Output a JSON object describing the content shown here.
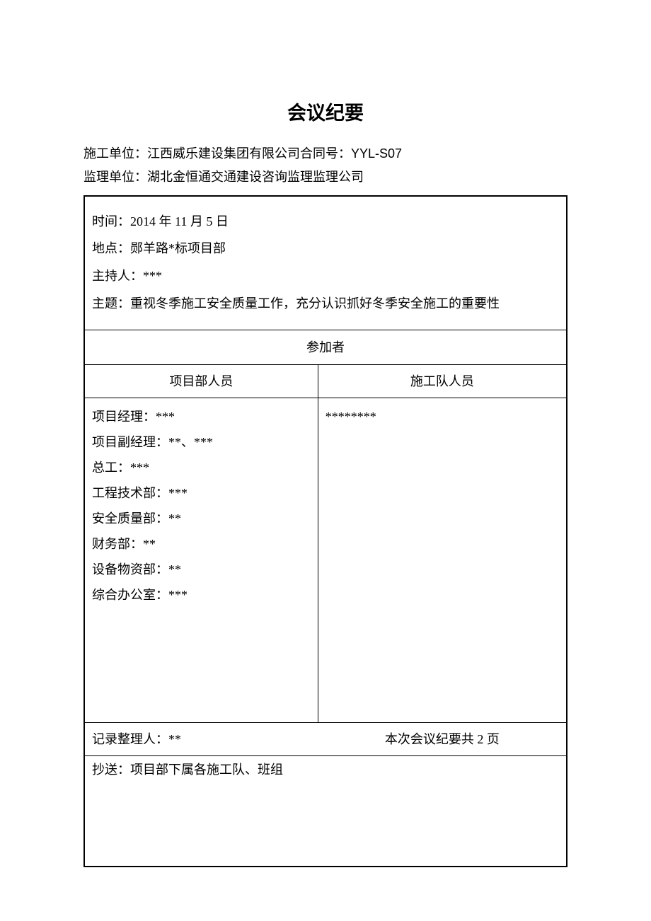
{
  "title": "会议纪要",
  "header": {
    "line1": "施工单位：江西威乐建设集团有限公司合同号：YYL-S07",
    "line2": "监理单位：湖北金恒通交通建设咨询监理监理公司"
  },
  "meta": {
    "time": "时间：2014 年 11 月 5 日",
    "place": "地点：郧羊路*标项目部",
    "host": "主持人：***",
    "topic": "主题：重视冬季施工安全质量工作，充分认识抓好冬季安全施工的重要性"
  },
  "participants": {
    "section_title": "参加者",
    "left_header": "项目部人员",
    "right_header": "施工队人员",
    "project_dept": [
      "项目经理：***",
      "项目副经理：**、***",
      "总工：***",
      "工程技术部：***",
      "安全质量部：**",
      "财务部：**",
      "设备物资部：**",
      "综合办公室：***"
    ],
    "construction_team": "********"
  },
  "footer": {
    "recorder": "记录整理人：**",
    "page_count": "本次会议纪要共 2 页",
    "cc": "抄送：项目部下属各施工队、班组"
  }
}
